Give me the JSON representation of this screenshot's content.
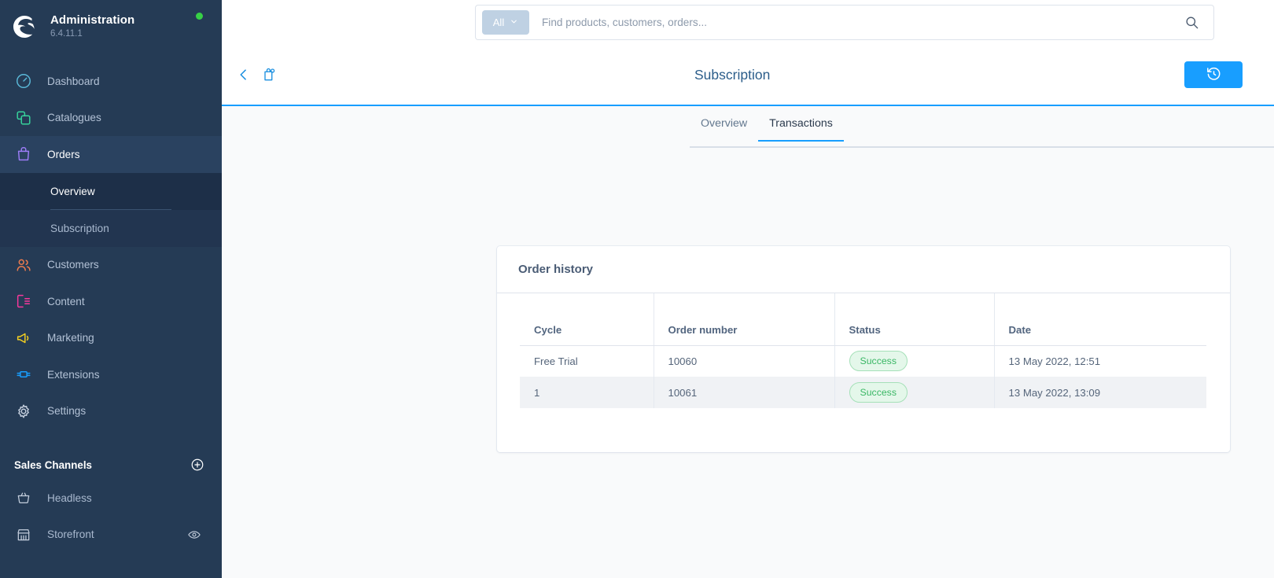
{
  "sidebar": {
    "brand": {
      "title": "Administration",
      "version": "6.4.11.1",
      "status_dot_color": "#37d046",
      "logo_icon": "shopware-logo-icon"
    },
    "items": [
      {
        "label": "Dashboard",
        "icon": "dashboard-icon",
        "color": "#5ab8d8",
        "active": false
      },
      {
        "label": "Catalogues",
        "icon": "catalogues-icon",
        "color": "#37d39b",
        "active": false
      },
      {
        "label": "Orders",
        "icon": "orders-bag-icon",
        "color": "#9b7cf5",
        "active": true
      },
      {
        "label": "Customers",
        "icon": "customers-icon",
        "color": "#ef7c4e",
        "active": false
      },
      {
        "label": "Content",
        "icon": "content-icon",
        "color": "#f6389c",
        "active": false
      },
      {
        "label": "Marketing",
        "icon": "megaphone-icon",
        "color": "#f5d020",
        "active": false
      },
      {
        "label": "Extensions",
        "icon": "extensions-icon",
        "color": "#189eff",
        "active": false
      },
      {
        "label": "Settings",
        "icon": "gear-icon",
        "color": "#c4cedd",
        "active": false
      }
    ],
    "sub_items": [
      {
        "label": "Overview",
        "active": true
      },
      {
        "label": "Subscription",
        "active": false
      }
    ],
    "sales_channels": {
      "title": "Sales Channels",
      "add_icon": "plus-circle-icon",
      "items": [
        {
          "label": "Headless",
          "icon": "basket-icon",
          "has_eye": false
        },
        {
          "label": "Storefront",
          "icon": "shop-icon",
          "has_eye": true,
          "eye_icon": "eye-icon"
        }
      ]
    }
  },
  "search": {
    "scope_label": "All",
    "scope_caret_icon": "chevron-down-icon",
    "placeholder": "Find products, customers, orders...",
    "value": "",
    "search_icon": "search-icon"
  },
  "page_header": {
    "back_icon": "chevron-left-icon",
    "context_icon": "order-lock-icon",
    "title": "Subscription",
    "action_icon": "history-rewind-icon",
    "action_color": "#189eff"
  },
  "tabs": [
    {
      "label": "Overview",
      "active": false
    },
    {
      "label": "Transactions",
      "active": true
    }
  ],
  "card": {
    "title": "Order history",
    "table": {
      "columns": [
        "Cycle",
        "Order number",
        "Status",
        "Date"
      ],
      "rows": [
        {
          "cycle": "Free Trial",
          "order_number": "10060",
          "status": "Success",
          "date": "13 May 2022, 12:51"
        },
        {
          "cycle": "1",
          "order_number": "10061",
          "status": "Success",
          "date": "13 May 2022, 13:09"
        }
      ]
    }
  }
}
